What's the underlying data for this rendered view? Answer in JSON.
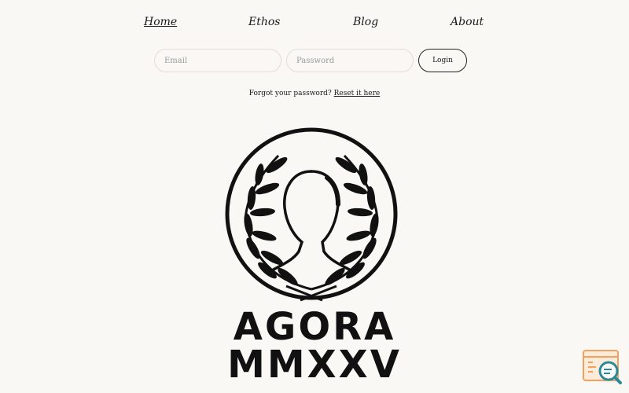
{
  "nav": {
    "items": [
      {
        "label": "Home",
        "active": true
      },
      {
        "label": "Ethos",
        "active": false
      },
      {
        "label": "Blog",
        "active": false
      },
      {
        "label": "About",
        "active": false
      }
    ]
  },
  "login": {
    "email_placeholder": "Email",
    "password_placeholder": "Password",
    "button_label": "Login",
    "forgot_text": "Forgot your password?",
    "reset_link": "Reset it here"
  },
  "brand": {
    "line1": "AGORA",
    "line2": "MMXXV",
    "emblem_icon": "laurel-wreath-head-silhouette-icon"
  },
  "widget": {
    "icon": "search-browser-icon",
    "colors": {
      "primary": "#f0a060",
      "secondary": "#2a8a9a"
    }
  }
}
